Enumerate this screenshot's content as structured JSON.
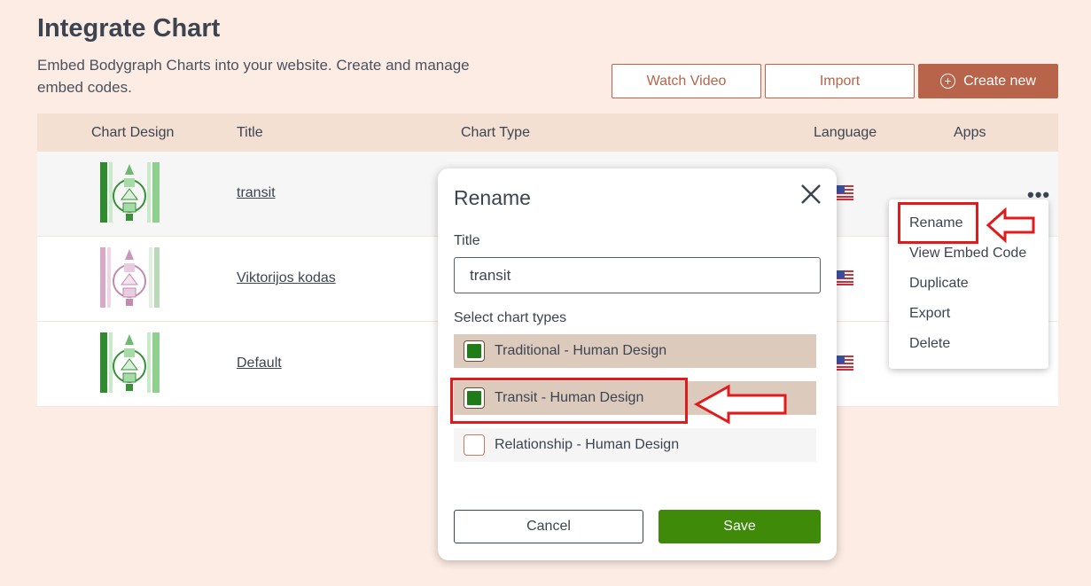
{
  "header": {
    "title": "Integrate Chart",
    "subtitle": "Embed Bodygraph Charts into your website. Create and manage embed codes.",
    "watch_video": "Watch Video",
    "import": "Import",
    "create_new": "Create new"
  },
  "table": {
    "columns": [
      "Chart Design",
      "Title",
      "Chart Type",
      "Language",
      "Apps"
    ],
    "rows": [
      {
        "title": "transit",
        "design_color": "green"
      },
      {
        "title": "Viktorijos kodas",
        "design_color": "pink"
      },
      {
        "title": "Default",
        "design_color": "green"
      }
    ]
  },
  "row_menu": {
    "items": [
      "Rename",
      "View Embed Code",
      "Duplicate",
      "Export",
      "Delete"
    ]
  },
  "modal": {
    "title": "Rename",
    "title_label": "Title",
    "title_value": "transit",
    "chart_types_label": "Select chart types",
    "chart_types": [
      {
        "label": "Traditional - Human Design",
        "checked": true
      },
      {
        "label": "Transit - Human Design",
        "checked": true
      },
      {
        "label": "Relationship - Human Design",
        "checked": false
      }
    ],
    "cancel": "Cancel",
    "save": "Save"
  },
  "colors": {
    "accent": "#b7644a",
    "save_green": "#3f8a08",
    "checkbox_green": "#1e7d18",
    "annotation_red": "#e11b1b"
  }
}
